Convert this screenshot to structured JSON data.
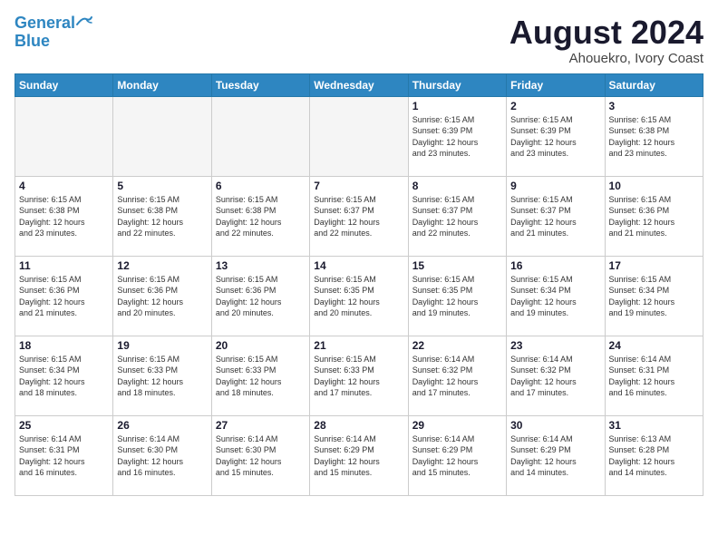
{
  "header": {
    "logo_line1": "General",
    "logo_line2": "Blue",
    "month_title": "August 2024",
    "location": "Ahouekro, Ivory Coast"
  },
  "days_of_week": [
    "Sunday",
    "Monday",
    "Tuesday",
    "Wednesday",
    "Thursday",
    "Friday",
    "Saturday"
  ],
  "weeks": [
    [
      {
        "day": "",
        "info": ""
      },
      {
        "day": "",
        "info": ""
      },
      {
        "day": "",
        "info": ""
      },
      {
        "day": "",
        "info": ""
      },
      {
        "day": "1",
        "info": "Sunrise: 6:15 AM\nSunset: 6:39 PM\nDaylight: 12 hours\nand 23 minutes."
      },
      {
        "day": "2",
        "info": "Sunrise: 6:15 AM\nSunset: 6:39 PM\nDaylight: 12 hours\nand 23 minutes."
      },
      {
        "day": "3",
        "info": "Sunrise: 6:15 AM\nSunset: 6:38 PM\nDaylight: 12 hours\nand 23 minutes."
      }
    ],
    [
      {
        "day": "4",
        "info": "Sunrise: 6:15 AM\nSunset: 6:38 PM\nDaylight: 12 hours\nand 23 minutes."
      },
      {
        "day": "5",
        "info": "Sunrise: 6:15 AM\nSunset: 6:38 PM\nDaylight: 12 hours\nand 22 minutes."
      },
      {
        "day": "6",
        "info": "Sunrise: 6:15 AM\nSunset: 6:38 PM\nDaylight: 12 hours\nand 22 minutes."
      },
      {
        "day": "7",
        "info": "Sunrise: 6:15 AM\nSunset: 6:37 PM\nDaylight: 12 hours\nand 22 minutes."
      },
      {
        "day": "8",
        "info": "Sunrise: 6:15 AM\nSunset: 6:37 PM\nDaylight: 12 hours\nand 22 minutes."
      },
      {
        "day": "9",
        "info": "Sunrise: 6:15 AM\nSunset: 6:37 PM\nDaylight: 12 hours\nand 21 minutes."
      },
      {
        "day": "10",
        "info": "Sunrise: 6:15 AM\nSunset: 6:36 PM\nDaylight: 12 hours\nand 21 minutes."
      }
    ],
    [
      {
        "day": "11",
        "info": "Sunrise: 6:15 AM\nSunset: 6:36 PM\nDaylight: 12 hours\nand 21 minutes."
      },
      {
        "day": "12",
        "info": "Sunrise: 6:15 AM\nSunset: 6:36 PM\nDaylight: 12 hours\nand 20 minutes."
      },
      {
        "day": "13",
        "info": "Sunrise: 6:15 AM\nSunset: 6:36 PM\nDaylight: 12 hours\nand 20 minutes."
      },
      {
        "day": "14",
        "info": "Sunrise: 6:15 AM\nSunset: 6:35 PM\nDaylight: 12 hours\nand 20 minutes."
      },
      {
        "day": "15",
        "info": "Sunrise: 6:15 AM\nSunset: 6:35 PM\nDaylight: 12 hours\nand 19 minutes."
      },
      {
        "day": "16",
        "info": "Sunrise: 6:15 AM\nSunset: 6:34 PM\nDaylight: 12 hours\nand 19 minutes."
      },
      {
        "day": "17",
        "info": "Sunrise: 6:15 AM\nSunset: 6:34 PM\nDaylight: 12 hours\nand 19 minutes."
      }
    ],
    [
      {
        "day": "18",
        "info": "Sunrise: 6:15 AM\nSunset: 6:34 PM\nDaylight: 12 hours\nand 18 minutes."
      },
      {
        "day": "19",
        "info": "Sunrise: 6:15 AM\nSunset: 6:33 PM\nDaylight: 12 hours\nand 18 minutes."
      },
      {
        "day": "20",
        "info": "Sunrise: 6:15 AM\nSunset: 6:33 PM\nDaylight: 12 hours\nand 18 minutes."
      },
      {
        "day": "21",
        "info": "Sunrise: 6:15 AM\nSunset: 6:33 PM\nDaylight: 12 hours\nand 17 minutes."
      },
      {
        "day": "22",
        "info": "Sunrise: 6:14 AM\nSunset: 6:32 PM\nDaylight: 12 hours\nand 17 minutes."
      },
      {
        "day": "23",
        "info": "Sunrise: 6:14 AM\nSunset: 6:32 PM\nDaylight: 12 hours\nand 17 minutes."
      },
      {
        "day": "24",
        "info": "Sunrise: 6:14 AM\nSunset: 6:31 PM\nDaylight: 12 hours\nand 16 minutes."
      }
    ],
    [
      {
        "day": "25",
        "info": "Sunrise: 6:14 AM\nSunset: 6:31 PM\nDaylight: 12 hours\nand 16 minutes."
      },
      {
        "day": "26",
        "info": "Sunrise: 6:14 AM\nSunset: 6:30 PM\nDaylight: 12 hours\nand 16 minutes."
      },
      {
        "day": "27",
        "info": "Sunrise: 6:14 AM\nSunset: 6:30 PM\nDaylight: 12 hours\nand 15 minutes."
      },
      {
        "day": "28",
        "info": "Sunrise: 6:14 AM\nSunset: 6:29 PM\nDaylight: 12 hours\nand 15 minutes."
      },
      {
        "day": "29",
        "info": "Sunrise: 6:14 AM\nSunset: 6:29 PM\nDaylight: 12 hours\nand 15 minutes."
      },
      {
        "day": "30",
        "info": "Sunrise: 6:14 AM\nSunset: 6:29 PM\nDaylight: 12 hours\nand 14 minutes."
      },
      {
        "day": "31",
        "info": "Sunrise: 6:13 AM\nSunset: 6:28 PM\nDaylight: 12 hours\nand 14 minutes."
      }
    ]
  ]
}
